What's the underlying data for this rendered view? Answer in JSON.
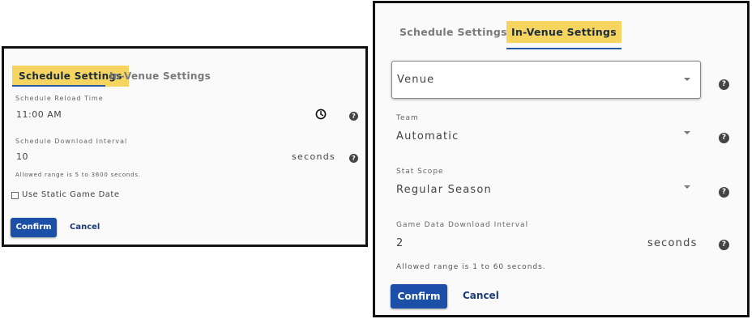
{
  "left_panel": {
    "tabs": [
      {
        "label": "Schedule Settings",
        "active": true
      },
      {
        "label": "In-Venue Settings",
        "active": false
      }
    ],
    "reload_time": {
      "label": "Schedule Reload Time",
      "value": "11:00 AM"
    },
    "download_interval": {
      "label": "Schedule Download Interval",
      "value": "10",
      "unit": "seconds"
    },
    "range_hint": "Allowed range is 5 to 3600 seconds.",
    "static_date": {
      "label": "Use Static Game Date",
      "checked": false
    },
    "confirm_label": "Confirm",
    "cancel_label": "Cancel"
  },
  "right_panel": {
    "tabs": [
      {
        "label": "Schedule Settings",
        "active": false
      },
      {
        "label": "In-Venue Settings",
        "active": true
      }
    ],
    "venue": {
      "placeholder": "Venue"
    },
    "team": {
      "label": "Team",
      "value": "Automatic"
    },
    "stat_scope": {
      "label": "Stat Scope",
      "value": "Regular Season"
    },
    "game_interval": {
      "label": "Game Data Download Interval",
      "value": "2",
      "unit": "seconds"
    },
    "range_hint": "Allowed range is 1 to 60 seconds.",
    "confirm_label": "Confirm",
    "cancel_label": "Cancel"
  },
  "icons": {
    "help": "help-circle-icon",
    "clock": "clock-icon",
    "dropdown": "chevron-down-icon"
  },
  "colors": {
    "highlight": "#f5d560",
    "primary": "#1b4fa8",
    "tab_underline": "#2757a8"
  }
}
